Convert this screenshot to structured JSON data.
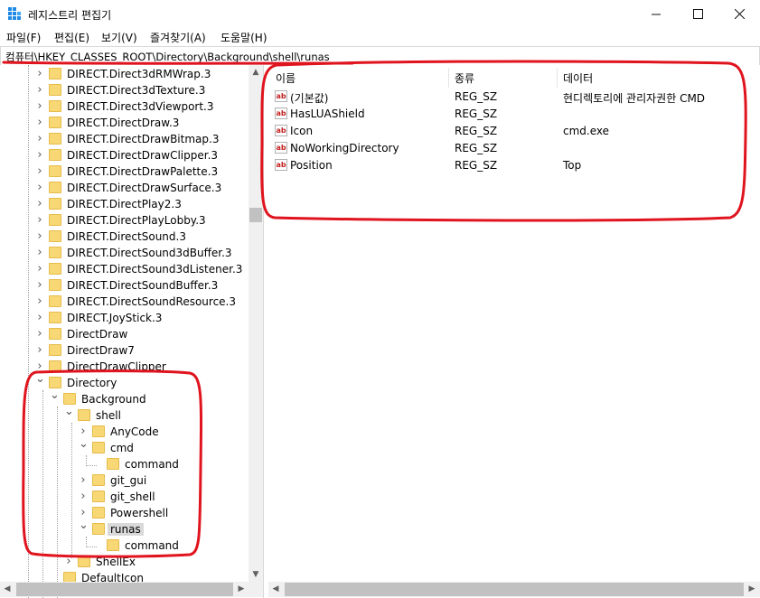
{
  "window": {
    "title": "레지스트리 편집기",
    "minimize_icon": "minimize-icon",
    "maximize_icon": "maximize-icon",
    "close_icon": "close-icon"
  },
  "menu": [
    "파일(F)",
    "편집(E)",
    "보기(V)",
    "즐겨찾기(A)",
    "도움말(H)"
  ],
  "address": "컴퓨터\\HKEY_CLASSES_ROOT\\Directory\\Background\\shell\\runas",
  "tree": [
    {
      "label": "DIRECT.Direct3dRMWrap.3",
      "expander": "collapsed"
    },
    {
      "label": "DIRECT.Direct3dTexture.3",
      "expander": "collapsed"
    },
    {
      "label": "DIRECT.Direct3dViewport.3",
      "expander": "collapsed"
    },
    {
      "label": "DIRECT.DirectDraw.3",
      "expander": "collapsed"
    },
    {
      "label": "DIRECT.DirectDrawBitmap.3",
      "expander": "collapsed"
    },
    {
      "label": "DIRECT.DirectDrawClipper.3",
      "expander": "collapsed"
    },
    {
      "label": "DIRECT.DirectDrawPalette.3",
      "expander": "collapsed"
    },
    {
      "label": "DIRECT.DirectDrawSurface.3",
      "expander": "collapsed"
    },
    {
      "label": "DIRECT.DirectPlay2.3",
      "expander": "collapsed"
    },
    {
      "label": "DIRECT.DirectPlayLobby.3",
      "expander": "collapsed"
    },
    {
      "label": "DIRECT.DirectSound.3",
      "expander": "collapsed"
    },
    {
      "label": "DIRECT.DirectSound3dBuffer.3",
      "expander": "collapsed"
    },
    {
      "label": "DIRECT.DirectSound3dListener.3",
      "expander": "collapsed"
    },
    {
      "label": "DIRECT.DirectSoundBuffer.3",
      "expander": "collapsed"
    },
    {
      "label": "DIRECT.DirectSoundResource.3",
      "expander": "collapsed"
    },
    {
      "label": "DIRECT.JoyStick.3",
      "expander": "collapsed"
    },
    {
      "label": "DirectDraw",
      "expander": "collapsed"
    },
    {
      "label": "DirectDraw7",
      "expander": "collapsed"
    },
    {
      "label": "DirectDrawClipper",
      "expander": "collapsed"
    },
    {
      "label": "Directory",
      "expander": "expanded"
    },
    {
      "label": "Background",
      "expander": "expanded"
    },
    {
      "label": "shell",
      "expander": "expanded"
    },
    {
      "label": "AnyCode",
      "expander": "collapsed"
    },
    {
      "label": "cmd",
      "expander": "expanded"
    },
    {
      "label": "command",
      "expander": "none"
    },
    {
      "label": "git_gui",
      "expander": "collapsed"
    },
    {
      "label": "git_shell",
      "expander": "collapsed"
    },
    {
      "label": "Powershell",
      "expander": "collapsed"
    },
    {
      "label": "runas",
      "expander": "expanded",
      "selected": true
    },
    {
      "label": "command",
      "expander": "none"
    },
    {
      "label": "ShellEx",
      "expander": "collapsed"
    },
    {
      "label": "DefaultIcon",
      "expander": "none"
    }
  ],
  "list": {
    "columns": [
      "이름",
      "종류",
      "데이터"
    ],
    "rows": [
      {
        "name": "(기본값)",
        "type": "REG_SZ",
        "data": "현디렉토리에 관리자권한 CMD"
      },
      {
        "name": "HasLUAShield",
        "type": "REG_SZ",
        "data": ""
      },
      {
        "name": "Icon",
        "type": "REG_SZ",
        "data": "cmd.exe"
      },
      {
        "name": "NoWorkingDirectory",
        "type": "REG_SZ",
        "data": ""
      },
      {
        "name": "Position",
        "type": "REG_SZ",
        "data": "Top"
      }
    ],
    "value_icon": "string-value-icon",
    "value_icon_text": "ab"
  },
  "colors": {
    "annotation": "#e0141e",
    "folder": "#f8d775",
    "selection": "#d9d9d9"
  }
}
